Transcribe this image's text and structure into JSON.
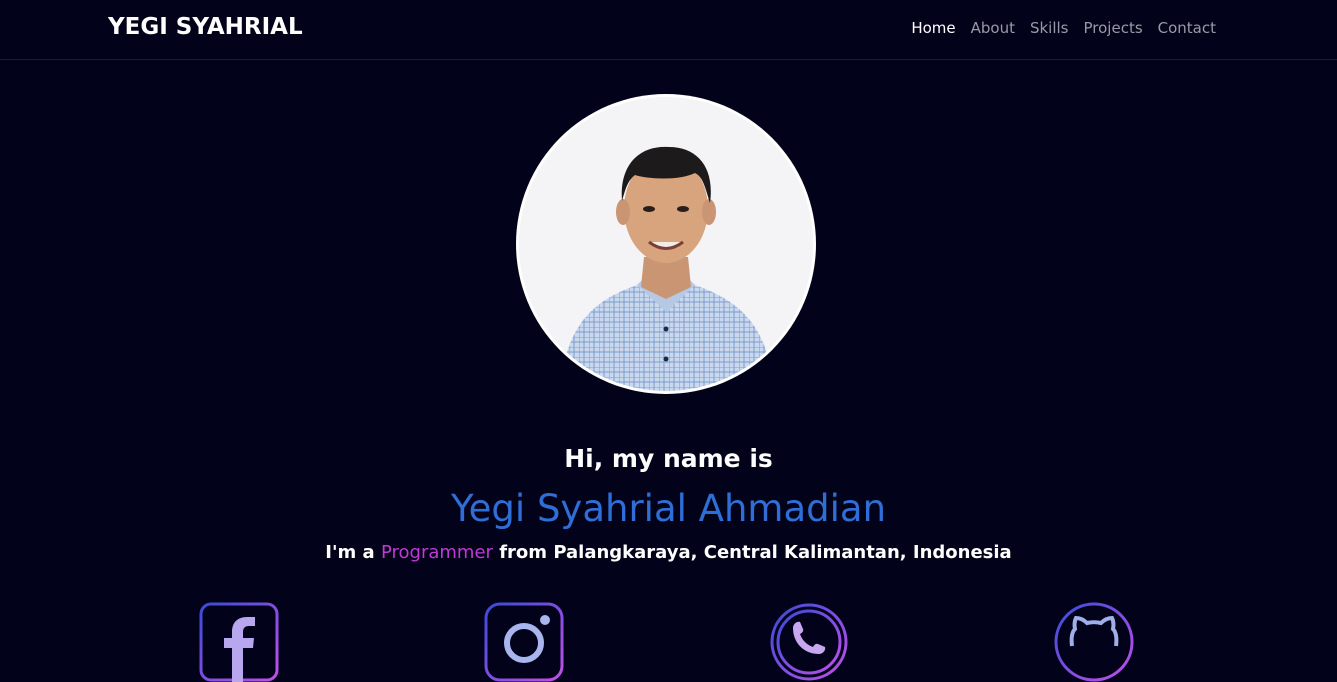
{
  "brand": "YEGI SYAHRIAL",
  "nav": {
    "items": [
      {
        "label": "Home",
        "active": true
      },
      {
        "label": "About",
        "active": false
      },
      {
        "label": "Skills",
        "active": false
      },
      {
        "label": "Projects",
        "active": false
      },
      {
        "label": "Contact",
        "active": false
      }
    ]
  },
  "hero": {
    "greeting": "Hi, my name is",
    "name": "Yegi Syahrial Ahmadian",
    "tagline_prefix": "I'm a",
    "role": "Programmer",
    "tagline_suffix": "from Palangkaraya, Central Kalimantan, Indonesia"
  },
  "social": [
    {
      "icon": "facebook-icon"
    },
    {
      "icon": "instagram-icon"
    },
    {
      "icon": "phone-icon"
    },
    {
      "icon": "github-icon"
    }
  ],
  "colors": {
    "background": "#02021a",
    "name": "#2e6ed6",
    "role": "#c13ad6",
    "nav_inactive": "#9a9aa6",
    "icon_gradient_start": "#3a4bd8",
    "icon_gradient_end": "#c050e8"
  }
}
